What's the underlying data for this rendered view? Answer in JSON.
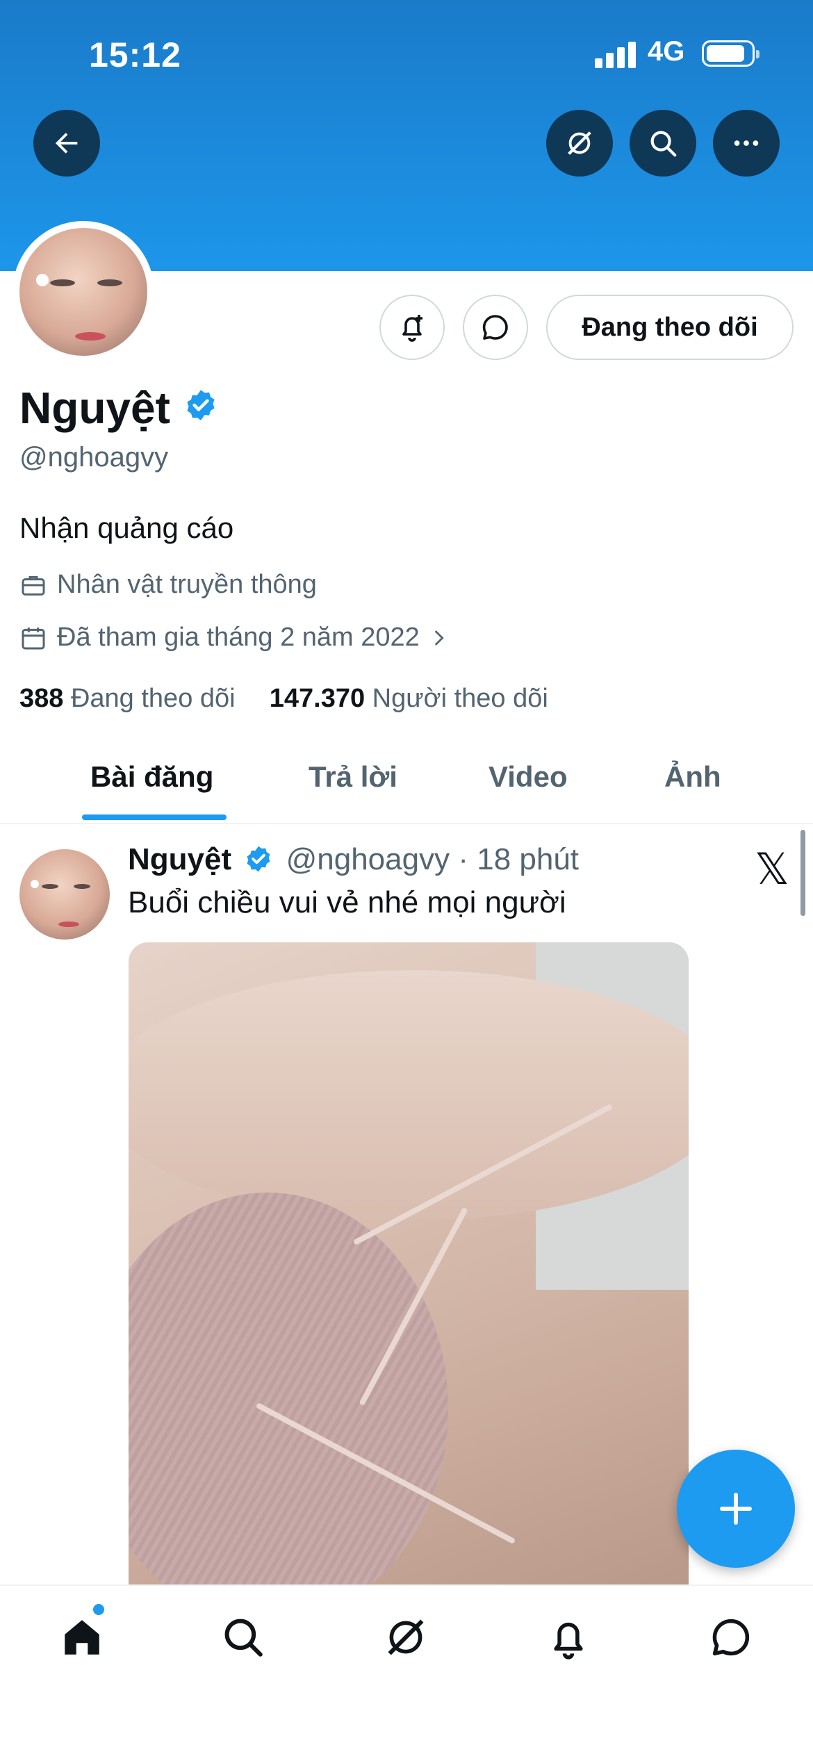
{
  "status_bar": {
    "time": "15:12",
    "network": "4G"
  },
  "header": {
    "back_icon": "back-arrow-icon",
    "actions": [
      "grok-icon",
      "search-icon",
      "more-icon"
    ]
  },
  "profile": {
    "name": "Nguyệt",
    "handle": "@nghoagvy",
    "bio": "Nhận quảng cáo",
    "category": "Nhân vật truyền thông",
    "joined": "Đã tham gia tháng 2 năm 2022",
    "following_count": "388",
    "following_label": "Đang theo dõi",
    "followers_count": "147.370",
    "followers_label": "Người theo dõi",
    "follow_button": "Đang theo dõi"
  },
  "tabs": [
    {
      "label": "Bài đăng",
      "active": true
    },
    {
      "label": "Trả lời",
      "active": false
    },
    {
      "label": "Video",
      "active": false
    },
    {
      "label": "Ảnh",
      "active": false
    }
  ],
  "post": {
    "author": "Nguyệt",
    "handle": "@nghoagvy",
    "separator": "·",
    "time": "18 phút",
    "text": "Buổi chiều vui vẻ nhé mọi người",
    "x_logo": "𝕏"
  },
  "colors": {
    "accent": "#1d9bf0",
    "banner": "#1d96ea",
    "text": "#0f1419",
    "secondary": "#536471"
  },
  "bottom_nav": [
    "home-icon",
    "search-icon",
    "grok-icon",
    "notifications-icon",
    "messages-icon"
  ]
}
